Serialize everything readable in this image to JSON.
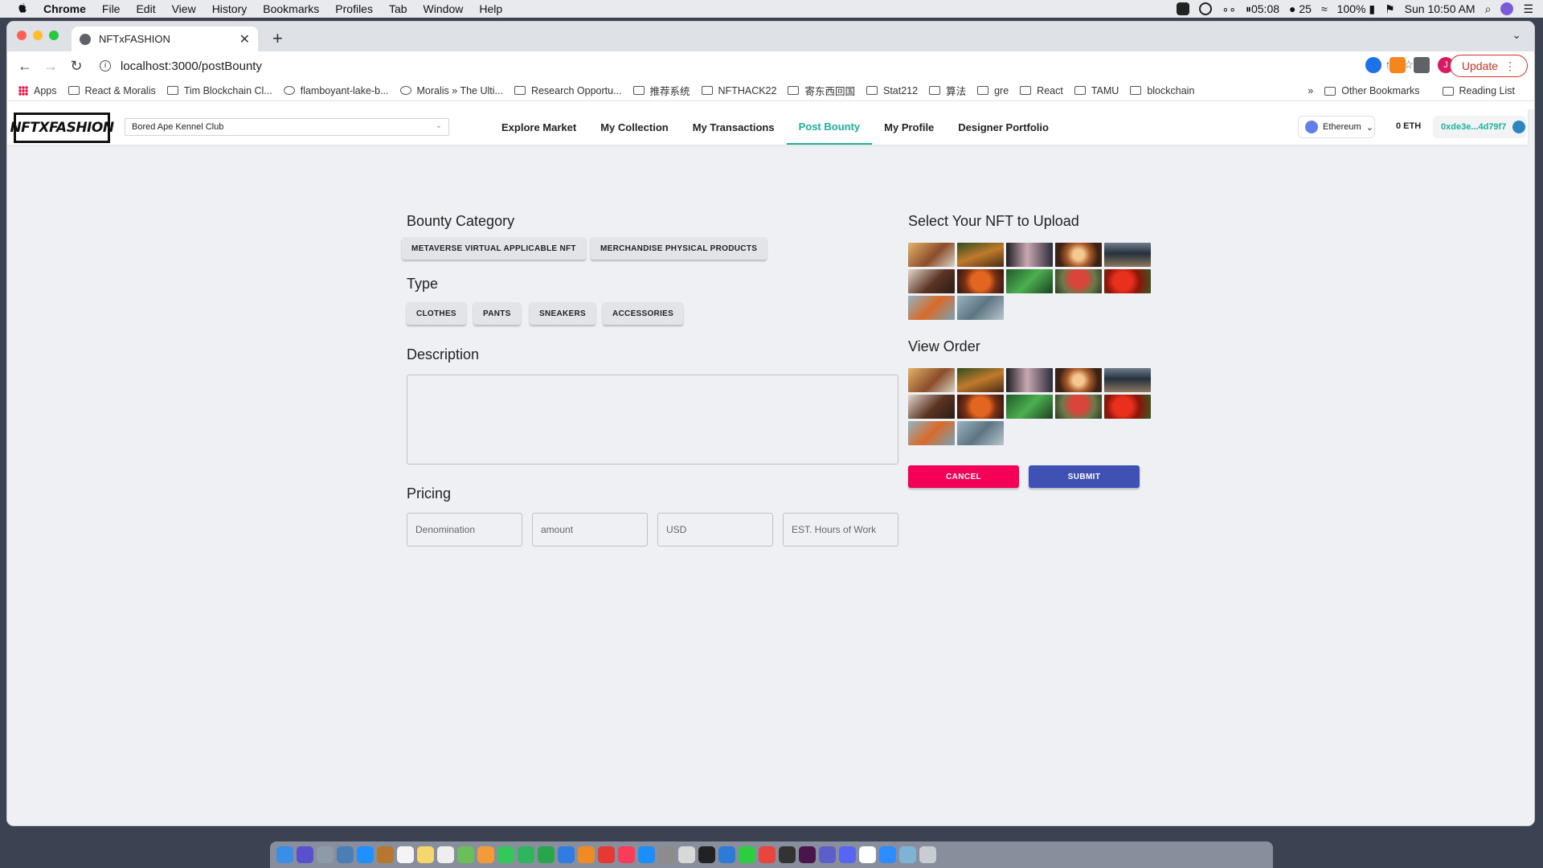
{
  "menubar": {
    "app": "Chrome",
    "items": [
      "File",
      "Edit",
      "View",
      "History",
      "Bookmarks",
      "Profiles",
      "Tab",
      "Window",
      "Help"
    ],
    "timer": "05:08",
    "wechat_count": "25",
    "battery": "100%",
    "datetime": "Sun 10:50 AM"
  },
  "browser": {
    "tab_title": "NFTxFASHION",
    "url": "localhost:3000/postBounty",
    "update_label": "Update",
    "profile_initial": "J",
    "bookmarks": [
      "Apps",
      "React & Moralis",
      "Tim Blockchain Cl...",
      "flamboyant-lake-b...",
      "Moralis » The Ulti...",
      "Research Opportu...",
      "推荐系统",
      "NFTHACK22",
      "寄东西回国",
      "Stat212",
      "算法",
      "gre",
      "React",
      "TAMU",
      "blockchain"
    ],
    "overflow": "»",
    "other_bookmarks": "Other Bookmarks",
    "reading_list": "Reading List"
  },
  "app": {
    "logo": "NFTXFASHION",
    "collection_select": "Bored Ape Kennel Club",
    "nav": [
      "Explore Market",
      "My Collection",
      "My Transactions",
      "Post Bounty",
      "My Profile",
      "Designer Portfolio"
    ],
    "active_nav": "Post Bounty",
    "network": "Ethereum",
    "balance": "0 ETH",
    "address": "0xde3e...4d79f7",
    "accent_color": "#1cb39c"
  },
  "form": {
    "bounty_category_label": "Bounty Category",
    "categories": [
      "METAVERSE VIRTUAL APPLICABLE NFT",
      "MERCHANDISE PHYSICAL PRODUCTS"
    ],
    "type_label": "Type",
    "types": [
      "CLOTHES",
      "PANTS",
      "SNEAKERS",
      "ACCESSORIES"
    ],
    "description_label": "Description",
    "pricing_label": "Pricing",
    "pricing_placeholders": [
      "Denomination",
      "amount",
      "USD",
      "EST. Hours of Work"
    ],
    "select_nft_label": "Select Your NFT to Upload",
    "view_order_label": "View Order",
    "cancel_label": "CANCEL",
    "submit_label": "SUBMIT",
    "cancel_color": "#f50057",
    "submit_color": "#3f51b5"
  },
  "thumbnails": [
    "food-photo",
    "burger-photo",
    "camera-photo",
    "latte-art-photo",
    "laptop-photo",
    "coffee-cup-photo",
    "basketball-photo",
    "palm-leaf-photo",
    "mushroom-photo",
    "tomatoes-photo",
    "starfish-photo",
    "rope-photo"
  ]
}
